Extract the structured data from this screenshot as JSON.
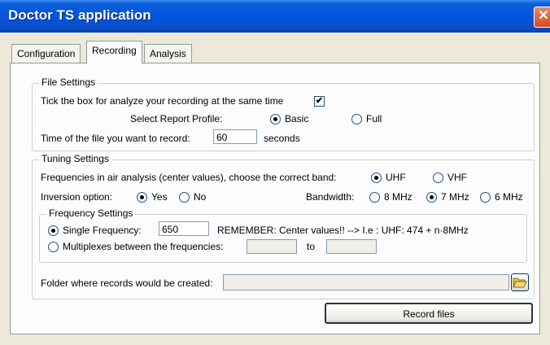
{
  "window": {
    "title": "Doctor TS application",
    "close_glyph": "✕"
  },
  "tabs": [
    {
      "label": "Configuration",
      "active": false
    },
    {
      "label": "Recording",
      "active": true
    },
    {
      "label": "Analysis",
      "active": false
    }
  ],
  "file_settings": {
    "legend": "File Settings",
    "analyze_label": "Tick the box for analyze your recording at the same time",
    "analyze_checked": true,
    "check_glyph": "✔",
    "report_profile_label": "Select Report Profile:",
    "profile_basic": "Basic",
    "profile_full": "Full",
    "profile_selected": "Basic",
    "time_label": "Time of the file you want to record:",
    "time_value": "60",
    "time_unit": "seconds"
  },
  "tuning_settings": {
    "legend": "Tuning Settings",
    "band_label": "Frequencies in air analysis (center values), choose the correct band:",
    "band_uhf": "UHF",
    "band_vhf": "VHF",
    "band_selected": "UHF",
    "inversion_label": "Inversion option:",
    "inversion_yes": "Yes",
    "inversion_no": "No",
    "inversion_selected": "Yes",
    "bandwidth_label": "Bandwidth:",
    "bw_8": "8 MHz",
    "bw_7": "7 MHz",
    "bw_6": "6 MHz",
    "bw_selected": "7 MHz"
  },
  "frequency_settings": {
    "legend": "Frequency Settings",
    "single_label": "Single Frequency:",
    "single_value": "650",
    "remember_text": "REMEMBER: Center values!! --> I.e : UHF: 474 + n·8MHz",
    "multiplex_label": "Multiplexes between the frequencies:",
    "multiplex_from": "",
    "to_label": "to",
    "multiplex_to": "",
    "selected": "single"
  },
  "folder": {
    "label": "Folder where records would be created:",
    "value": "",
    "browse_icon": "folder-open-icon"
  },
  "record_button": "Record files"
}
